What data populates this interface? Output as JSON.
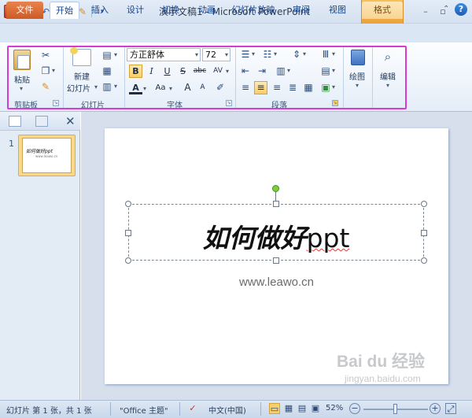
{
  "window": {
    "app_icon": "P",
    "title": "演示文稿1 - Microsoft PowerPoint",
    "contextual_tab": "绘图工具"
  },
  "quick_access": {
    "icons": [
      "save-icon",
      "undo-icon",
      "redo-icon",
      "customize-qat-icon"
    ]
  },
  "tabs": {
    "file": "文件",
    "items": [
      "开始",
      "插入",
      "设计",
      "切换",
      "动画",
      "幻灯片放映",
      "审阅",
      "视图",
      "格式"
    ],
    "active": "开始"
  },
  "ribbon": {
    "clipboard": {
      "paste_label": "粘贴",
      "group_label": "剪贴板"
    },
    "slides": {
      "new_slide_label": "新建\n幻灯片",
      "new_slide_line1": "新建",
      "new_slide_line2": "幻灯片",
      "group_label": "幻灯片"
    },
    "font": {
      "font_name": "方正舒体",
      "font_size": "72",
      "group_label": "字体",
      "bold": "B",
      "italic": "I",
      "underline": "U",
      "strike": "S",
      "strike_abc": "abc",
      "spacing": "AV",
      "font_color": "A",
      "change_case": "Aa",
      "grow": "A",
      "shrink": "A"
    },
    "paragraph": {
      "group_label": "段落"
    },
    "drawing": {
      "label": "绘图"
    },
    "editing": {
      "label": "编辑"
    },
    "highlight_color": "#d63bd6"
  },
  "slide_panel": {
    "slide_number": "1",
    "thumb_title": "如何做好ppt",
    "thumb_sub": "www.leawo.cn"
  },
  "slide": {
    "title_chinese": "如何做好",
    "title_latin": "ppt",
    "subtitle": "www.leawo.cn"
  },
  "watermark": {
    "logo": "Bai du 经验",
    "url": "jingyan.baidu.com"
  },
  "status": {
    "slide_info": "幻灯片 第 1 张，共 1 张",
    "theme": "\"Office 主题\"",
    "language": "中文(中国)",
    "zoom": "52%",
    "zoom_level": 0.52
  }
}
